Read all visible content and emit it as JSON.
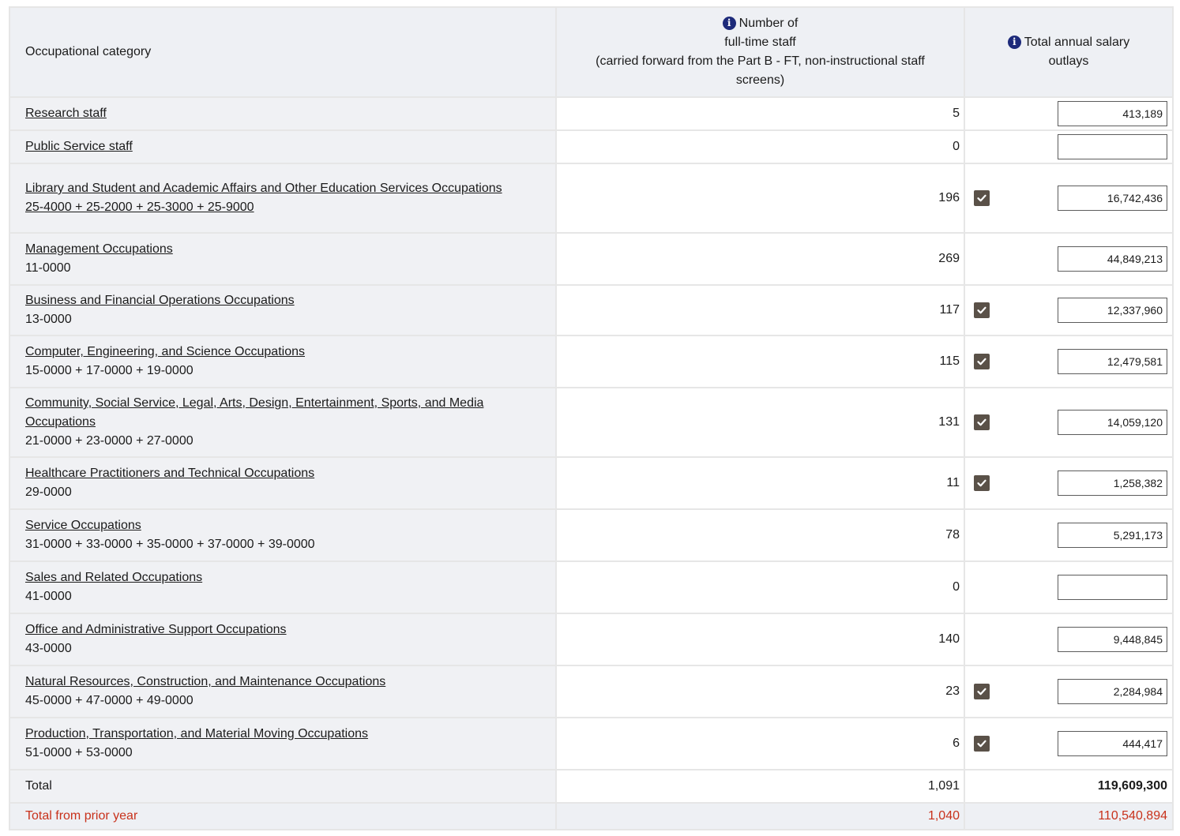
{
  "header": {
    "category": "Occupational category",
    "staff_lines": [
      "Number of",
      "full-time staff",
      "(carried forward from the Part B - FT, non-instructional staff",
      "screens)"
    ],
    "salary_lines": [
      "Total annual salary",
      "outlays"
    ]
  },
  "rows": [
    {
      "label": "Research staff",
      "code": "",
      "code_link": false,
      "staff": "5",
      "checked": false,
      "salary": "413,189"
    },
    {
      "label": "Public Service staff",
      "code": "",
      "code_link": false,
      "staff": "0",
      "checked": false,
      "salary": ""
    },
    {
      "label": "Library and Student and Academic Affairs and Other Education Services Occupations",
      "code": "25-4000 + 25-2000 + 25-3000 + 25-9000",
      "code_link": true,
      "staff": "196",
      "checked": true,
      "salary": "16,742,436"
    },
    {
      "label": "Management Occupations",
      "code": "11-0000",
      "code_link": false,
      "staff": "269",
      "checked": false,
      "salary": "44,849,213"
    },
    {
      "label": "Business and Financial Operations Occupations",
      "code": "13-0000",
      "code_link": false,
      "staff": "117",
      "checked": true,
      "salary": "12,337,960"
    },
    {
      "label": "Computer, Engineering, and Science Occupations",
      "code": "15-0000 + 17-0000 + 19-0000",
      "code_link": false,
      "staff": "115",
      "checked": true,
      "salary": "12,479,581"
    },
    {
      "label": "Community, Social Service, Legal, Arts, Design, Entertainment, Sports, and Media Occupations",
      "code": "21-0000 + 23-0000 + 27-0000",
      "code_link": false,
      "staff": "131",
      "checked": true,
      "salary": "14,059,120"
    },
    {
      "label": "Healthcare Practitioners and Technical Occupations",
      "code": "29-0000",
      "code_link": false,
      "staff": "11",
      "checked": true,
      "salary": "1,258,382"
    },
    {
      "label": "Service Occupations",
      "code": "31-0000 + 33-0000 + 35-0000 + 37-0000 + 39-0000",
      "code_link": false,
      "staff": "78",
      "checked": false,
      "salary": "5,291,173"
    },
    {
      "label": "Sales and Related Occupations",
      "code": "41-0000",
      "code_link": false,
      "staff": "0",
      "checked": false,
      "salary": ""
    },
    {
      "label": "Office and Administrative Support Occupations",
      "code": "43-0000",
      "code_link": false,
      "staff": "140",
      "checked": false,
      "salary": "9,448,845"
    },
    {
      "label": "Natural Resources, Construction, and Maintenance Occupations",
      "code": "45-0000 + 47-0000 + 49-0000",
      "code_link": false,
      "staff": "23",
      "checked": true,
      "salary": "2,284,984"
    },
    {
      "label": "Production, Transportation, and Material Moving Occupations",
      "code": "51-0000 + 53-0000",
      "code_link": false,
      "staff": "6",
      "checked": true,
      "salary": "444,417"
    }
  ],
  "total": {
    "label": "Total",
    "staff": "1,091",
    "salary": "119,609,300"
  },
  "prior": {
    "label": "Total from prior year",
    "staff": "1,040",
    "salary": "110,540,894"
  },
  "colors": {
    "header_bg": "#eef0f4",
    "checkbox": "#5a5148",
    "info_icon": "#1d2a7a",
    "prior_text": "#c8311b"
  }
}
